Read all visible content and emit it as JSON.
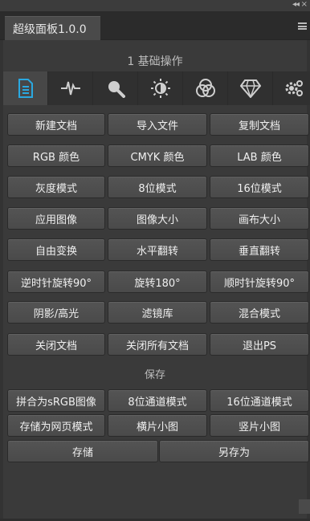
{
  "window": {
    "collapse_glyph": "◂◂",
    "close_glyph": "×"
  },
  "tab": {
    "label": "超级面板1.0.0"
  },
  "panel": {
    "title": "1 基础操作"
  },
  "toolbar_icons": [
    "document-icon",
    "waveform-icon",
    "search-icon",
    "brightness-icon",
    "color-circles-icon",
    "diamond-icon",
    "settings-icon"
  ],
  "buttons": {
    "rows": [
      [
        "新建文档",
        "导入文件",
        "复制文档"
      ],
      [
        "RGB 颜色",
        "CMYK 颜色",
        "LAB 颜色"
      ],
      [
        "灰度模式",
        "8位模式",
        "16位模式"
      ],
      [
        "应用图像",
        "图像大小",
        "画布大小"
      ],
      [
        "自由变换",
        "水平翻转",
        "垂直翻转"
      ],
      [
        "逆时针旋转90°",
        "旋转180°",
        "顺时针旋转90°"
      ],
      [
        "阴影/高光",
        "滤镜库",
        "混合模式"
      ],
      [
        "关闭文档",
        "关闭所有文档",
        "退出PS"
      ]
    ]
  },
  "save_section": {
    "title": "保存",
    "rows": [
      [
        "拼合为sRGB图像",
        "8位通道模式",
        "16位通道模式"
      ],
      [
        "存储为网页模式",
        "横片小图",
        "竖片小图"
      ]
    ],
    "save": "存储",
    "save_as": "另存为"
  },
  "colors": {
    "active_icon": "#2aa8e0",
    "icon": "#cfcfcf",
    "panel_bg": "#3a3a3a",
    "button_bg": "#4e4e4e"
  }
}
